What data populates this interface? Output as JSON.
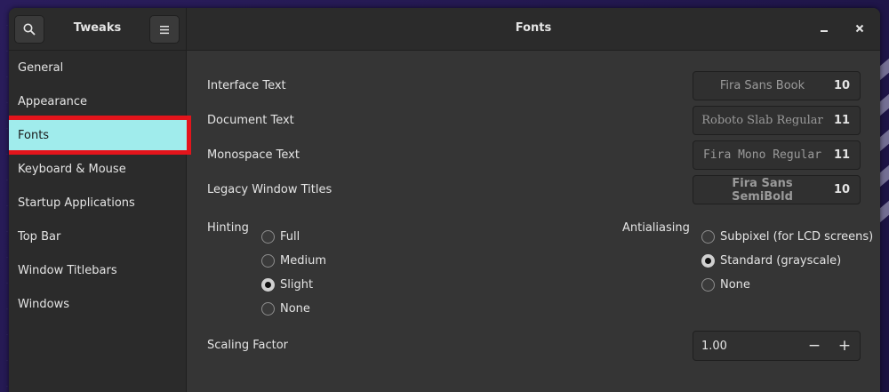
{
  "app": {
    "title": "Tweaks"
  },
  "page": {
    "title": "Fonts"
  },
  "sidebar": {
    "items": [
      {
        "label": "General"
      },
      {
        "label": "Appearance"
      },
      {
        "label": "Fonts"
      },
      {
        "label": "Keyboard & Mouse"
      },
      {
        "label": "Startup Applications"
      },
      {
        "label": "Top Bar"
      },
      {
        "label": "Window Titlebars"
      },
      {
        "label": "Windows"
      }
    ],
    "active": "Fonts"
  },
  "fonts": {
    "interface": {
      "label": "Interface Text",
      "font": "Fira Sans Book",
      "size": "10"
    },
    "document": {
      "label": "Document Text",
      "font": "Roboto Slab Regular",
      "size": "11"
    },
    "monospace": {
      "label": "Monospace Text",
      "font": "Fira Mono Regular",
      "size": "11"
    },
    "legacy": {
      "label": "Legacy Window Titles",
      "font": "Fira Sans SemiBold",
      "size": "10"
    }
  },
  "hinting": {
    "label": "Hinting",
    "options": [
      "Full",
      "Medium",
      "Slight",
      "None"
    ],
    "selected": "Slight"
  },
  "antialiasing": {
    "label": "Antialiasing",
    "options": [
      "Subpixel (for LCD screens)",
      "Standard (grayscale)",
      "None"
    ],
    "selected": "Standard (grayscale)"
  },
  "scaling": {
    "label": "Scaling Factor",
    "value": "1.00",
    "minus": "−",
    "plus": "+"
  },
  "icons": {
    "search": "search-icon",
    "menu": "hamburger-menu-icon",
    "minimize": "minimize-icon",
    "close": "close-icon"
  },
  "colors": {
    "active_bg": "#a0ecec",
    "highlight_border": "#e3141b",
    "window_bg": "#353535",
    "sidebar_bg": "#2b2b2b"
  }
}
